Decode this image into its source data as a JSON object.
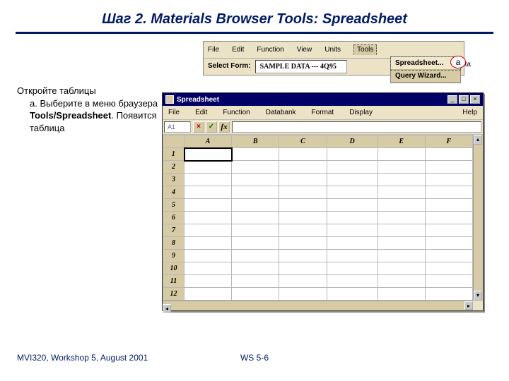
{
  "title": "Шаг 2.  Materials Browser Tools:  Spreadsheet",
  "instructions": {
    "heading": "Откройте таблицы",
    "item_a_1": "Выберите в меню браузера ",
    "item_a_bold": "Tools/Spreadsheet",
    "item_a_2": ". Появится таблица"
  },
  "toolbar": {
    "menu": {
      "file": "File",
      "edit": "Edit",
      "function": "Function",
      "view": "View",
      "units": "Units",
      "tools": "Tools"
    },
    "select_form_label": "Select Form:",
    "select_form_value": "SAMPLE DATA --- 4Q95",
    "dropdown": {
      "spreadsheet": "Spreadsheet...",
      "query": "Query Wizard..."
    },
    "mats_data": "ls Data",
    "callout": "a"
  },
  "spreadsheet": {
    "title": "Spreadsheet",
    "winbtn": {
      "min": "_",
      "max": "□",
      "close": "×"
    },
    "menu": {
      "file": "File",
      "edit": "Edit",
      "function": "Function",
      "databank": "Databank",
      "format": "Format",
      "display": "Display",
      "help": "Help"
    },
    "cellref": "A1",
    "fxbtn": {
      "x": "×",
      "check": "✓",
      "fx": "fx"
    },
    "cols": [
      "A",
      "B",
      "C",
      "D",
      "E",
      "F"
    ],
    "rows": [
      "1",
      "2",
      "3",
      "4",
      "5",
      "6",
      "7",
      "8",
      "9",
      "10",
      "11",
      "12"
    ]
  },
  "footer": {
    "left": "MVI320, Workshop 5, August 2001",
    "center": "WS 5-6"
  }
}
